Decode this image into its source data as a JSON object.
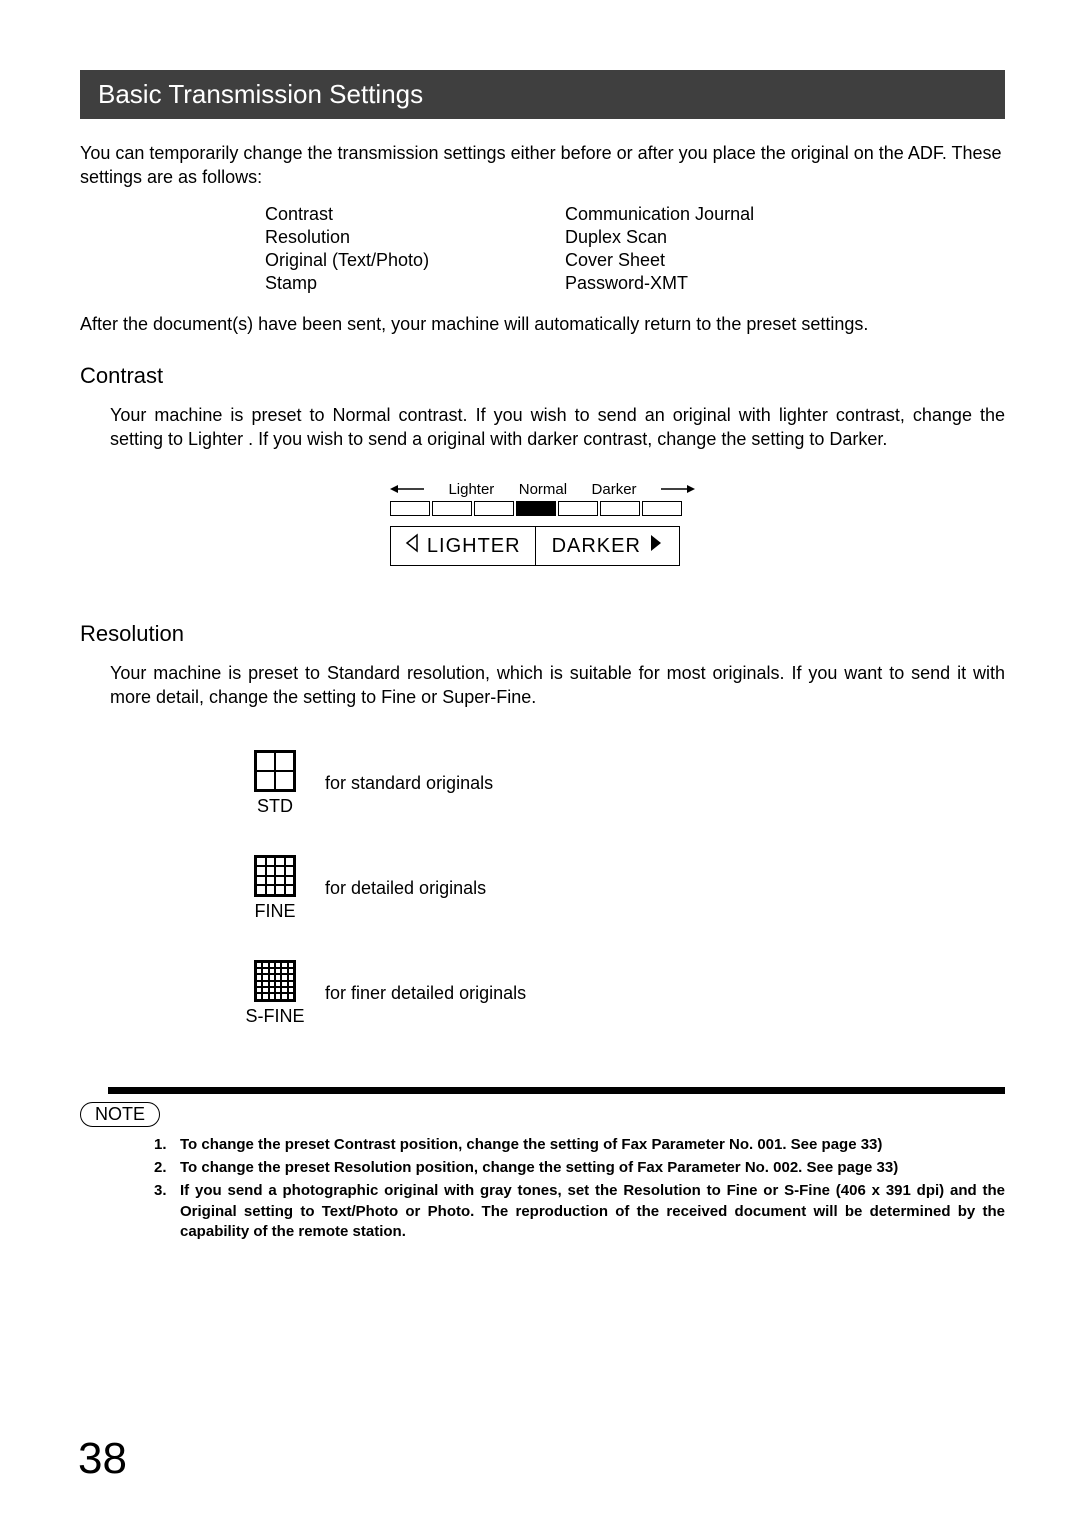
{
  "title": "Basic Transmission Settings",
  "intro": "You can temporarily change the transmission settings either before or after you place the original on the ADF. These settings are as follows:",
  "settings_col1": {
    "a": "Contrast",
    "b": "Resolution",
    "c": "Original (Text/Photo)",
    "d": "Stamp"
  },
  "settings_col2": {
    "a": "Communication Journal",
    "b": "Duplex Scan",
    "c": "Cover Sheet",
    "d": "Password-XMT"
  },
  "after": "After the document(s) have been sent, your machine will automatically return to the preset settings.",
  "contrast": {
    "heading": "Contrast",
    "body": "Your machine is preset to Normal  contrast.  If you wish to send an original with lighter contrast, change the setting to Lighter .  If you wish to send a original with darker contrast, change the setting to Darker.",
    "label_lighter": "Lighter",
    "label_normal": "Normal",
    "label_darker": "Darker",
    "btn_lighter": "LIGHTER",
    "btn_darker": "DARKER"
  },
  "resolution": {
    "heading": "Resolution",
    "body": "Your machine is preset to Standard resolution, which is suitable for most originals.  If you want to send it with more detail, change the setting to Fine or Super-Fine.",
    "std_label": "STD",
    "std_desc": "for standard originals",
    "fine_label": "FINE",
    "fine_desc": "for detailed originals",
    "sfine_label": "S-FINE",
    "sfine_desc": "for finer detailed originals"
  },
  "note": {
    "label": "NOTE",
    "n1": "To change the preset Contrast position, change the setting of Fax Parameter No. 001.  See page 33)",
    "n2": "To change the preset Resolution position, change the setting of Fax Parameter No. 002.  See page 33)",
    "n3": "If you send a photographic original with gray tones, set the Resolution to Fine or S-Fine (406 x 391 dpi) and the Original setting to Text/Photo or Photo.  The reproduction of the received document will be determined by the capability of the remote station."
  },
  "page_number": "38"
}
